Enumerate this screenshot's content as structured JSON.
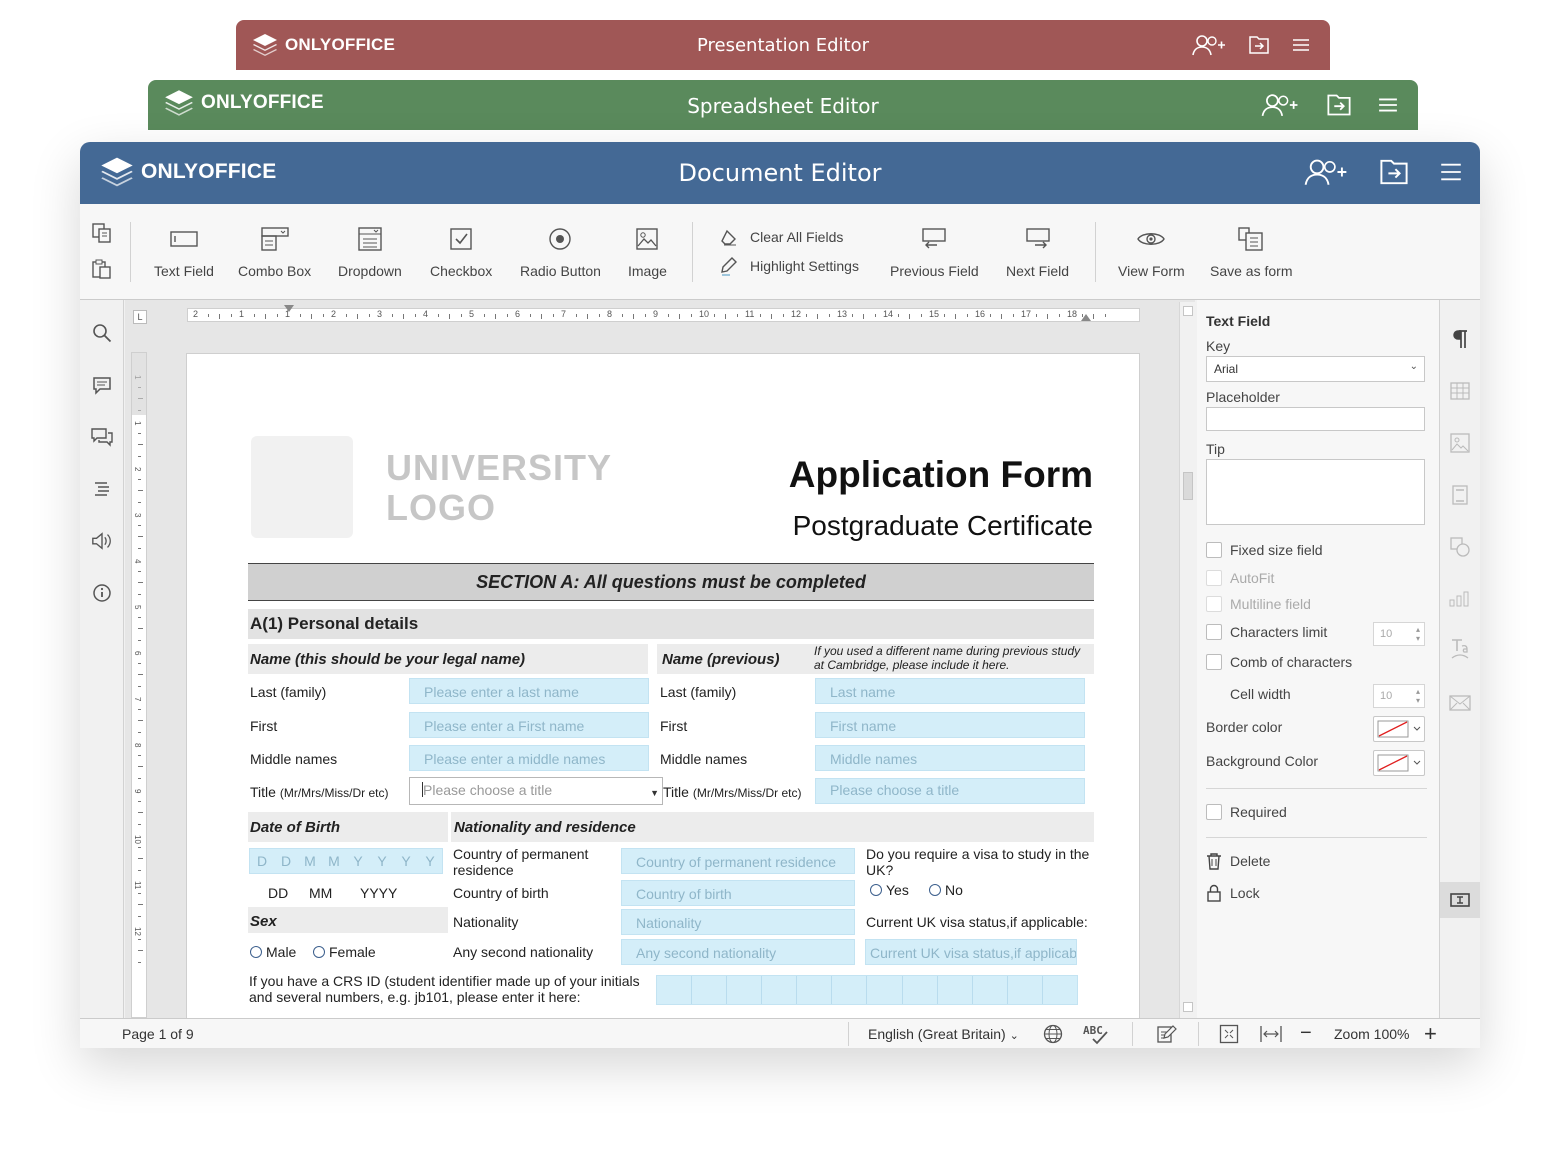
{
  "brand": "ONLYOFFICE",
  "colors": {
    "presentation": "#a05756",
    "spreadsheet": "#5a8a5c",
    "document": "#446995",
    "field_fill": "#d4eef9"
  },
  "windows": {
    "presentation": {
      "title": "Presentation Editor"
    },
    "spreadsheet": {
      "title": "Spreadsheet Editor"
    },
    "document": {
      "title": "Document Editor"
    }
  },
  "header_icons": [
    "add-user-icon",
    "open-location-icon",
    "menu-icon"
  ],
  "toolbar": {
    "text_field": "Text Field",
    "combo_box": "Combo Box",
    "dropdown": "Dropdown",
    "checkbox": "Checkbox",
    "radio_button": "Radio Button",
    "image": "Image",
    "clear_all_fields": "Clear All Fields",
    "highlight_settings": "Highlight Settings",
    "previous_field": "Previous Field",
    "next_field": "Next Field",
    "view_form": "View Form",
    "save_as_form": "Save as form"
  },
  "ruler": {
    "h_ticks": [
      "2",
      "1",
      "1",
      "2",
      "3",
      "4",
      "5",
      "6",
      "7",
      "8",
      "9",
      "10",
      "11",
      "12",
      "13",
      "14",
      "15",
      "16",
      "17",
      "18"
    ],
    "v_ticks": [
      "1",
      "1",
      "2",
      "3",
      "4",
      "5",
      "6",
      "7",
      "8",
      "9",
      "10",
      "11",
      "12"
    ]
  },
  "form": {
    "logo_line1": "UNIVERSITY",
    "logo_line2": "LOGO",
    "title": "Application Form",
    "subtitle": "Postgraduate Certificate",
    "section": "SECTION A: All questions must be completed",
    "personal_header": "A(1) Personal details",
    "name_legal": "Name (this should be your legal name)",
    "name_previous": "Name (previous)",
    "previous_note": "If you used a different name during previous study at Cambridge, please include it here.",
    "last_family": "Last (family)",
    "first": "First",
    "middle_names": "Middle names",
    "title_label": "Title",
    "title_hint": "(Mr/Mrs/Miss/Dr etc)",
    "ph_last": "Please enter a last name",
    "ph_first": "Please enter a First name",
    "ph_middle": "Please enter a middle names",
    "ph_title": "Please choose a title",
    "ph_last_prev": "Last name",
    "ph_first_prev": "First name",
    "ph_middle_prev": "Middle names",
    "ph_title_prev": "Please choose a title",
    "dob": "Date of Birth",
    "dob_cells": [
      "D",
      "D",
      "M",
      "M",
      "Y",
      "Y",
      "Y",
      "Y"
    ],
    "dd": "DD",
    "mm": "MM",
    "yyyy": "YYYY",
    "nationality_header": "Nationality and residence",
    "country_residence": "Country of permanent residence",
    "country_birth": "Country of birth",
    "nationality": "Nationality",
    "second_nationality": "Any second nationality",
    "ph_residence": "Country of permanent residence",
    "ph_birth": "Country of birth",
    "ph_nationality": "Nationality",
    "ph_second": "Any second nationality",
    "visa_question": "Do you require a visa to study in the UK?",
    "yes": "Yes",
    "no": "No",
    "visa_status": "Current UK visa status,if applicable:",
    "ph_visa": "Current UK visa status,if applicab",
    "sex": "Sex",
    "male": "Male",
    "female": "Female",
    "crs_text": "If you have a CRS ID (student identifier made up of your initials and several numbers, e.g. jb101, please enter it here:"
  },
  "panel": {
    "header": "Text Field",
    "key": "Key",
    "key_value": "Arial",
    "placeholder": "Placeholder",
    "tip": "Tip",
    "fixed_size": "Fixed size  field",
    "autofit": "AutoFit",
    "multiline": "Multiline field",
    "chars_limit": "Characters limit",
    "chars_value": "10",
    "comb": "Comb of characters",
    "cell_width": "Cell width",
    "cell_value": "10",
    "border_color": "Border color",
    "background_color": "Background Color",
    "required": "Required",
    "delete": "Delete",
    "lock": "Lock"
  },
  "status": {
    "page": "Page 1 of 9",
    "language": "English  (Great Britain)",
    "zoom": "Zoom 100%"
  }
}
